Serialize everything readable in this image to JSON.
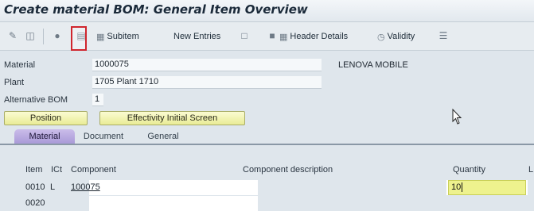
{
  "window": {
    "title": "Create material BOM: General Item Overview"
  },
  "toolbar": {
    "subitem_label": "Subitem",
    "new_entries_label": "New Entries",
    "header_details_label": "Header Details",
    "validity_label": "Validity"
  },
  "header": {
    "material": {
      "label": "Material",
      "value": "1000075",
      "description": "LENOVA MOBILE"
    },
    "plant": {
      "label": "Plant",
      "value": "1705 Plant 1710"
    },
    "alternative_bom": {
      "label": "Alternative BOM",
      "value": "1"
    }
  },
  "buttons": {
    "position_label": "Position",
    "effectivity_label": "Effectivity Initial Screen"
  },
  "tabs": [
    {
      "label": "Material",
      "active": true
    },
    {
      "label": "Document",
      "active": false
    },
    {
      "label": "General",
      "active": false
    }
  ],
  "table": {
    "headers": {
      "item": "Item",
      "ict": "ICt",
      "component": "Component",
      "component_description": "Component description",
      "quantity": "Quantity",
      "unit": "L"
    },
    "rows": [
      {
        "item": "0010",
        "ict": "L",
        "component": "100075",
        "description": "",
        "quantity": "10"
      },
      {
        "item": "0020",
        "ict": "",
        "component": "",
        "description": "",
        "quantity": ""
      }
    ]
  },
  "colors": {
    "accent_tab": "#a99ad8",
    "button_yellow": "#e9ec96",
    "selection_red": "#d0262e",
    "input_yellow": "#eef28e"
  }
}
